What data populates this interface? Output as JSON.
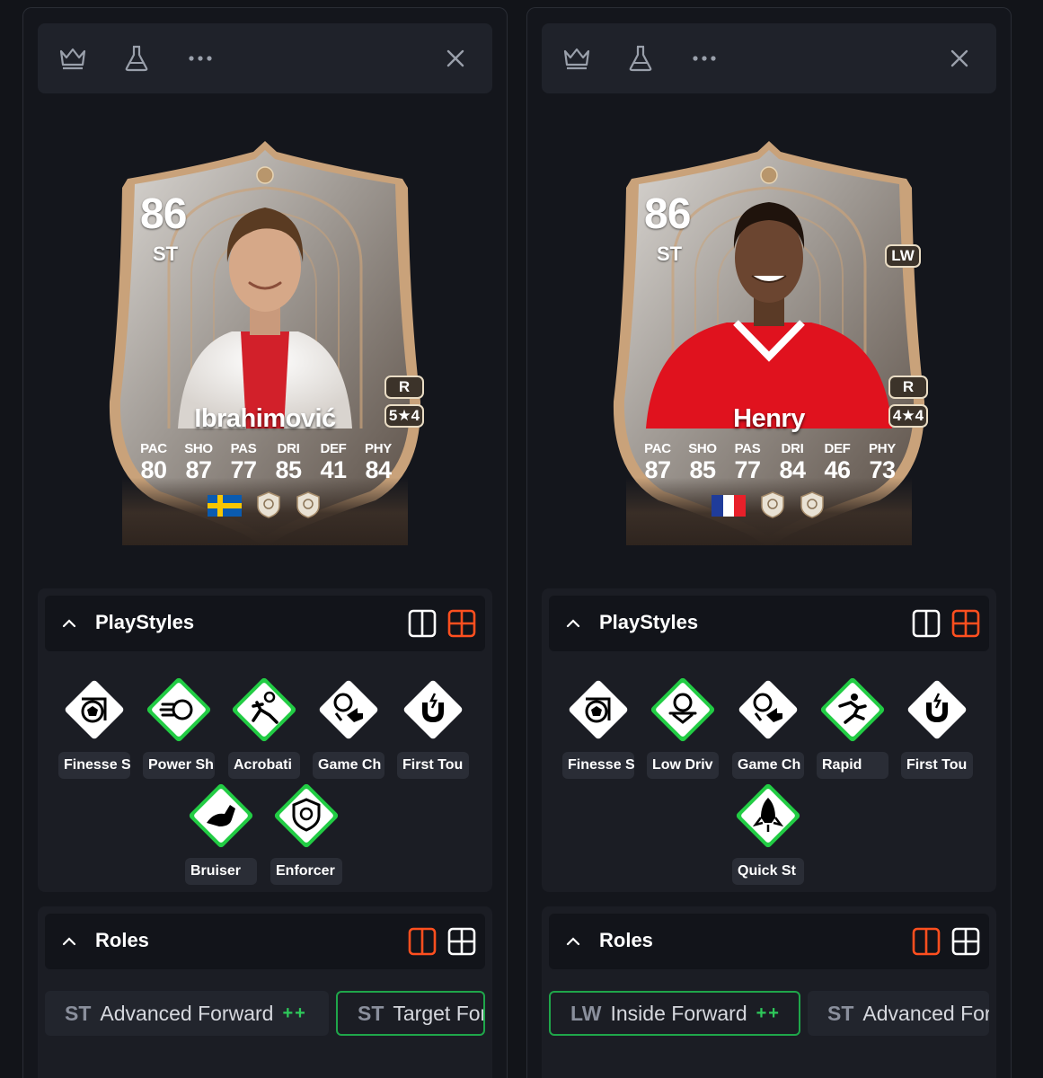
{
  "panels": [
    {
      "player": {
        "rating": "86",
        "position": "ST",
        "alt_position": "",
        "name": "Ibrahimović",
        "weak_foot": "R",
        "skills": "5★4",
        "nation": "Sweden",
        "stats": [
          {
            "label": "PAC",
            "value": "80"
          },
          {
            "label": "SHO",
            "value": "87"
          },
          {
            "label": "PAS",
            "value": "77"
          },
          {
            "label": "DRI",
            "value": "85"
          },
          {
            "label": "DEF",
            "value": "41"
          },
          {
            "label": "PHY",
            "value": "84"
          }
        ]
      },
      "playstyles": {
        "title": "PlayStyles",
        "items": [
          {
            "label": "Finesse S",
            "icon": "finesse-shot-icon",
            "plus": false
          },
          {
            "label": "Power Sh",
            "icon": "power-shot-icon",
            "plus": true
          },
          {
            "label": "Acrobati",
            "icon": "acrobatic-icon",
            "plus": true
          },
          {
            "label": "Game Ch",
            "icon": "game-changer-icon",
            "plus": false
          },
          {
            "label": "First Tou",
            "icon": "first-touch-icon",
            "plus": false
          },
          {
            "label": "Bruiser",
            "icon": "bruiser-icon",
            "plus": true
          },
          {
            "label": "Enforcer",
            "icon": "enforcer-icon",
            "plus": true
          }
        ]
      },
      "roles": {
        "title": "Roles",
        "items": [
          {
            "pos": "ST",
            "name": "Advanced Forward",
            "plus": "++",
            "active": false
          },
          {
            "pos": "ST",
            "name": "Target For",
            "plus": "",
            "active": true
          }
        ]
      }
    },
    {
      "player": {
        "rating": "86",
        "position": "ST",
        "alt_position": "LW",
        "name": "Henry",
        "weak_foot": "R",
        "skills": "4★4",
        "nation": "France",
        "stats": [
          {
            "label": "PAC",
            "value": "87"
          },
          {
            "label": "SHO",
            "value": "85"
          },
          {
            "label": "PAS",
            "value": "77"
          },
          {
            "label": "DRI",
            "value": "84"
          },
          {
            "label": "DEF",
            "value": "46"
          },
          {
            "label": "PHY",
            "value": "73"
          }
        ]
      },
      "playstyles": {
        "title": "PlayStyles",
        "items": [
          {
            "label": "Finesse S",
            "icon": "finesse-shot-icon",
            "plus": false
          },
          {
            "label": "Low Driv",
            "icon": "low-driven-shot-icon",
            "plus": true
          },
          {
            "label": "Game Ch",
            "icon": "game-changer-icon",
            "plus": false
          },
          {
            "label": "Rapid",
            "icon": "rapid-icon",
            "plus": true
          },
          {
            "label": "First Tou",
            "icon": "first-touch-icon",
            "plus": false
          },
          {
            "label": "Quick St",
            "icon": "quick-step-icon",
            "plus": true
          }
        ]
      },
      "roles": {
        "title": "Roles",
        "items": [
          {
            "pos": "LW",
            "name": "Inside Forward",
            "plus": "++",
            "active": true
          },
          {
            "pos": "ST",
            "name": "Advanced For",
            "plus": "",
            "active": false
          }
        ]
      }
    }
  ],
  "colors": {
    "accent_orange": "#ff4f1f",
    "plus_green": "#22cc44",
    "card_gold": "#c9a27a",
    "background": "#121419"
  }
}
